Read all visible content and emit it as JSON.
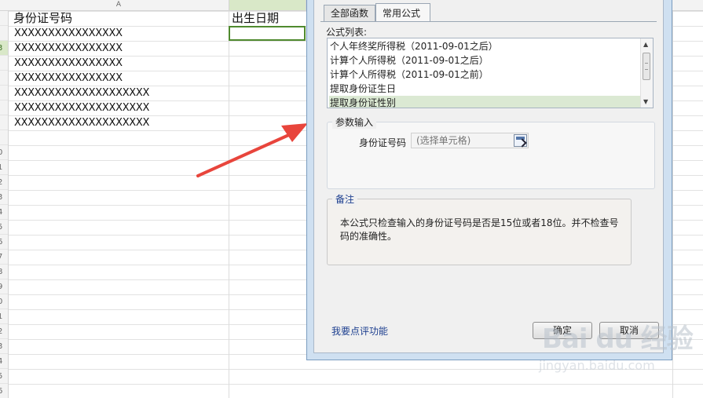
{
  "sheet": {
    "column_label": "A",
    "headers": {
      "id_header": "身份证号码",
      "birth_header": "出生日期"
    },
    "rows": [
      "XXXXXXXXXXXXXXXX",
      "XXXXXXXXXXXXXXXX",
      "XXXXXXXXXXXXXXXX",
      "XXXXXXXXXXXXXXXX",
      "XXXXXXXXXXXXXXXXXXXX",
      "XXXXXXXXXXXXXXXXXXXX",
      "XXXXXXXXXXXXXXXXXXXX"
    ],
    "row_numbers": [
      "",
      "",
      "3",
      "",
      "",
      "",
      "",
      "",
      "",
      "0",
      "1",
      "2",
      "3",
      "4",
      "5",
      "6",
      "7",
      "8",
      "9",
      "0",
      "1",
      "2",
      "3",
      "4",
      "5",
      "6"
    ]
  },
  "dialog": {
    "tabs": {
      "all_functions": "全部函数",
      "common_formulas": "常用公式"
    },
    "formula_list_label": "公式列表:",
    "formula_list": [
      "个人年终奖所得税（2011-09-01之后）",
      "计算个人所得税（2011-09-01之后）",
      "计算个人所得税（2011-09-01之前）",
      "提取身份证生日",
      "提取身份证性别"
    ],
    "params": {
      "title": "参数输入",
      "id_label": "身份证号码",
      "cell_placeholder": "(选择单元格)"
    },
    "notes": {
      "title": "备注",
      "text": "本公式只检查输入的身份证号码是否是15位或者18位。并不检查号码的准确性。"
    },
    "feedback_link": "我要点评功能",
    "ok_label": "确定",
    "cancel_label": "取消"
  },
  "colors": {
    "selection_green": "#4f8a2e",
    "list_selected": "#dbe9d3",
    "arrow_red": "#e8453c",
    "link_blue": "#1d3f8f"
  },
  "watermark": {
    "logo": "Bai du 经验",
    "sub": "jingyan.baidu.com"
  }
}
